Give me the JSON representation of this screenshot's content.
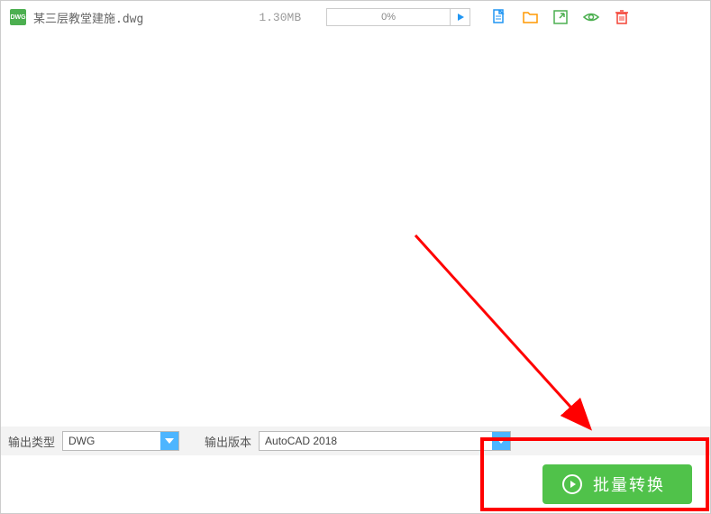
{
  "file_row": {
    "badge": "DWG",
    "filename": "某三层教堂建施.dwg",
    "size": "1.30MB",
    "progress": "0%"
  },
  "bottom_bar": {
    "type_label": "输出类型",
    "type_value": "DWG",
    "version_label": "输出版本",
    "version_value": "AutoCAD 2018"
  },
  "convert_button": "批量转换"
}
